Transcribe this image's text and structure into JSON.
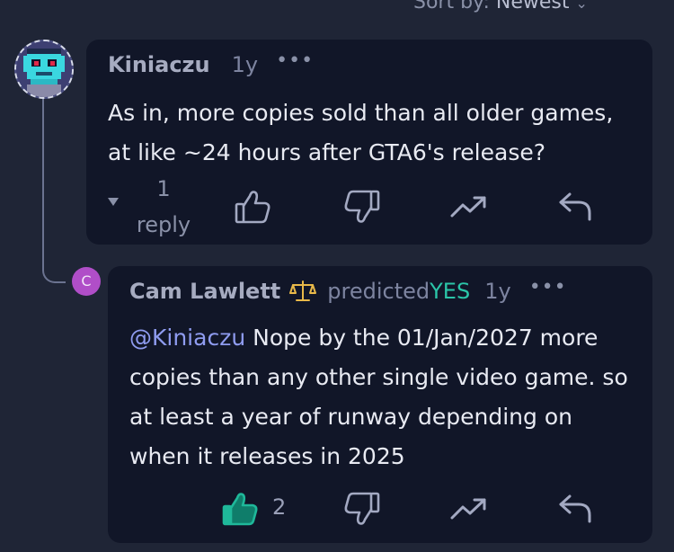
{
  "sort": {
    "label": "Sort by:",
    "value": "Newest"
  },
  "comments": [
    {
      "author": "Kiniaczu",
      "time": "1y",
      "more": "•••",
      "text": "As in, more copies sold than all older games, at like ~24 hours after GTA6's release?",
      "lines": [
        "As in, more copies sold than all older games,",
        "at like ~24 hours after GTA6's release?"
      ],
      "reply_count": "1",
      "reply_label": "reply",
      "collapse_icon": "caret-down-icon"
    },
    {
      "author": "Cam Lawlett",
      "avatar_letter": "C",
      "badge_icon": "scales-icon",
      "predicted_label": "predicted",
      "predicted_value": "YES",
      "time": "1y",
      "more": "•••",
      "mention": "@Kiniaczu",
      "lines": [
        "Nope by the 01/Jan/2027 more",
        "copies than any other single video game. so",
        "at least a year of runway depending on",
        "when it releases in 2025"
      ],
      "like_count": "2"
    }
  ],
  "colors": {
    "accent_yes": "#2bc5a8",
    "mention": "#8f9cf0",
    "card_bg": "#111628",
    "page_bg": "#1f2536"
  }
}
